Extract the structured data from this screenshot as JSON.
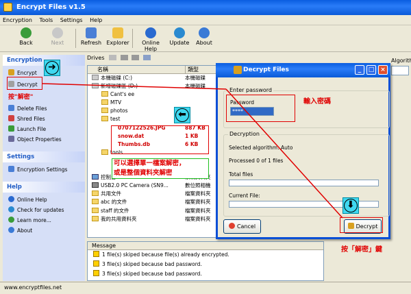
{
  "window": {
    "title": "Encrypt Files v1.5"
  },
  "menu": [
    "Encryption",
    "Tools",
    "Settings",
    "Help"
  ],
  "toolbar": {
    "back": "Back",
    "next": "Next",
    "refresh": "Refresh",
    "explorer": "Explorer",
    "online_help": "Online Help",
    "update": "Update",
    "about": "About"
  },
  "left": {
    "encryption": {
      "header": "Encryption",
      "items": [
        "Encrypt",
        "Decrypt"
      ],
      "annotation": "按\"解密\"",
      "tasks": [
        "Delete Files",
        "Shred Files",
        "Launch File",
        "Object Properties"
      ]
    },
    "settings": {
      "header": "Settings",
      "items": [
        "Encryption Settings"
      ]
    },
    "help": {
      "header": "Help",
      "items": [
        "Online Help",
        "Check for updates",
        "Learn more...",
        "About"
      ]
    }
  },
  "drives_label": "Drives",
  "tree": {
    "col_name": "名稱",
    "col_type": "類型",
    "rows": [
      {
        "name": "本機磁碟 (C:)",
        "type": "本機磁碟"
      },
      {
        "name": "新增磁碟區 (D:)",
        "type": "本機磁碟"
      },
      {
        "name": "Cant's ee",
        "type": ""
      },
      {
        "name": "MTV",
        "type": ""
      },
      {
        "name": "photos",
        "type": ""
      },
      {
        "name": "test",
        "type": ""
      },
      {
        "name": "0707122526.JPG",
        "size": "887 KB"
      },
      {
        "name": "snow.dat",
        "size": "1 KB"
      },
      {
        "name": "Thumbs.db",
        "size": "6 KB"
      },
      {
        "name": "tools",
        "type": ""
      },
      {
        "name": "",
        "type": ""
      },
      {
        "name": "",
        "type": ""
      },
      {
        "name": "控制台",
        "type": "系統資料夾"
      },
      {
        "name": "USB2.0 PC Camera (SN9...",
        "type": "數位照相機"
      },
      {
        "name": "共用文件",
        "type": "檔案資料夾"
      },
      {
        "name": "abc 的文件",
        "type": "檔案資料夾"
      },
      {
        "name": "staff 的文件",
        "type": "檔案資料夾"
      },
      {
        "name": "我的共用資料夾",
        "type": "檔案資料夾"
      }
    ],
    "note_line1": "可以選擇單一檔案解密，",
    "note_line2": "或是整個資料夾解密"
  },
  "messages": {
    "header": "Message",
    "items": [
      "1 file(s) skiped because file(s) already encrypted.",
      "3 file(s) skiped because bad password.",
      "3 file(s) skiped because bad password."
    ]
  },
  "status": "www.encryptfiles.net",
  "right": {
    "label": "Algorithm"
  },
  "dialog": {
    "title": "Decrypt Files",
    "enter_password": "Enter password",
    "password_label": "Password",
    "password_value": "****",
    "password_note": "輸入密碼",
    "decryption": "Decryption",
    "algorithm": "Selected algorithm: Auto",
    "processed": "Processed 0 of 1 files",
    "total_files": "Total files",
    "current_file": "Current File:",
    "cancel": "Cancel",
    "decrypt": "Decrypt",
    "decrypt_note": "按「解密」鍵"
  }
}
